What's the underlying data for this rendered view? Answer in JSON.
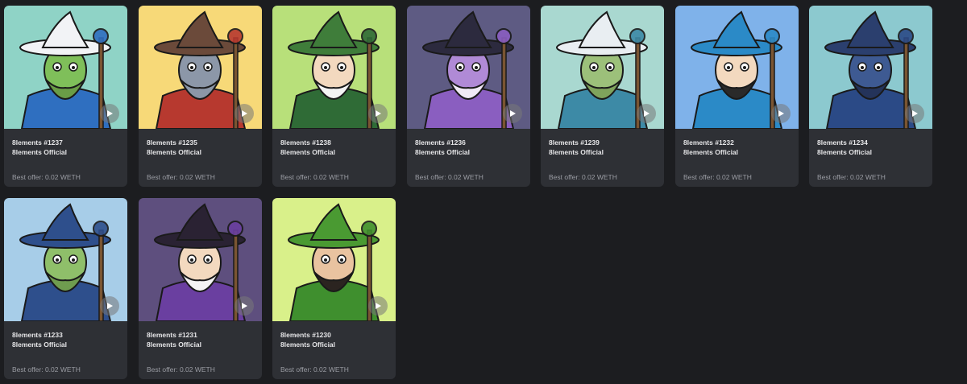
{
  "cards": [
    {
      "name": "8lements #1237",
      "collection": "8lements Official",
      "offer": "Best offer: 0.02 WETH",
      "bg": "#8fd3c6",
      "hat": "#f2f3f6",
      "face": "#7fbf5a",
      "beard": "#6a9d47",
      "cloak": "#2f6fc0"
    },
    {
      "name": "8lements #1235",
      "collection": "8lements Official",
      "offer": "Best offer: 0.02 WETH",
      "bg": "#f7d978",
      "hat": "#6b4a3a",
      "face": "#8c97a8",
      "beard": "#8c97a8",
      "cloak": "#b7392f"
    },
    {
      "name": "8lements #1238",
      "collection": "8lements Official",
      "offer": "Best offer: 0.02 WETH",
      "bg": "#b8e07a",
      "hat": "#3f7d3a",
      "face": "#f3d9bf",
      "beard": "#f4f4f4",
      "cloak": "#2f6b36"
    },
    {
      "name": "8lements #1236",
      "collection": "8lements Official",
      "offer": "Best offer: 0.02 WETH",
      "bg": "#5e5b83",
      "hat": "#2c2a3e",
      "face": "#b08ad6",
      "beard": "#f0eaf6",
      "cloak": "#8a5ec0"
    },
    {
      "name": "8lements #1239",
      "collection": "8lements Official",
      "offer": "Best offer: 0.02 WETH",
      "bg": "#a9d8d0",
      "hat": "#e9eef2",
      "face": "#9cc07a",
      "beard": "#7fa35c",
      "cloak": "#3d8aa6"
    },
    {
      "name": "8lements #1232",
      "collection": "8lements Official",
      "offer": "Best offer: 0.02 WETH",
      "bg": "#7fb2ea",
      "hat": "#2b8ac7",
      "face": "#f3d9bf",
      "beard": "#2a2a2a",
      "cloak": "#2b8ac7"
    },
    {
      "name": "8lements #1234",
      "collection": "8lements Official",
      "offer": "Best offer: 0.02 WETH",
      "bg": "#8cc9cf",
      "hat": "#2b3f6e",
      "face": "#3e5a92",
      "beard": "#24335a",
      "cloak": "#2b4a86"
    },
    {
      "name": "8lements #1233",
      "collection": "8lements Official",
      "offer": "Best offer: 0.02 WETH",
      "bg": "#a7cde8",
      "hat": "#2e4f8c",
      "face": "#8fbf6a",
      "beard": "#6f9c4f",
      "cloak": "#2e4f8c"
    },
    {
      "name": "8lements #1231",
      "collection": "8lements Official",
      "offer": "Best offer: 0.02 WETH",
      "bg": "#5e4f7e",
      "hat": "#2a2233",
      "face": "#f3d9bf",
      "beard": "#f4f4f4",
      "cloak": "#6a3fa0"
    },
    {
      "name": "8lements #1230",
      "collection": "8lements Official",
      "offer": "Best offer: 0.02 WETH",
      "bg": "#d9f08a",
      "hat": "#4a9a32",
      "face": "#e9c3a0",
      "beard": "#2b2420",
      "cloak": "#3f8f2e"
    }
  ],
  "icons": {
    "play": "play-icon"
  }
}
